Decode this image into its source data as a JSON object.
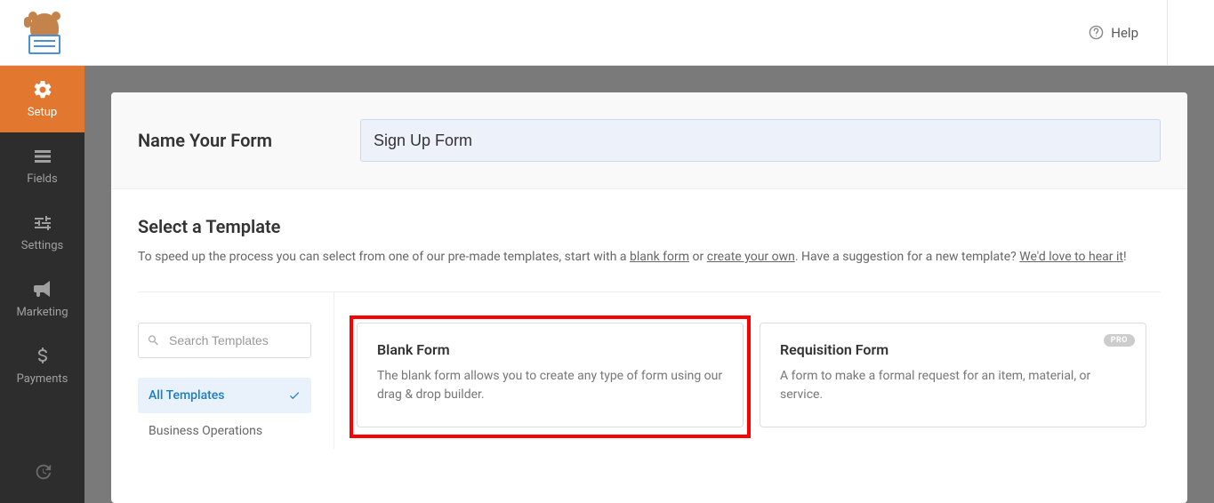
{
  "topbar": {
    "help_label": "Help"
  },
  "sidebar": {
    "items": [
      {
        "label": "Setup"
      },
      {
        "label": "Fields"
      },
      {
        "label": "Settings"
      },
      {
        "label": "Marketing"
      },
      {
        "label": "Payments"
      }
    ]
  },
  "name_section": {
    "label": "Name Your Form",
    "value": "Sign Up Form"
  },
  "template_section": {
    "title": "Select a Template",
    "desc_prefix": "To speed up the process you can select from one of our pre-made templates, start with a ",
    "blank_link": "blank form",
    "desc_mid": " or ",
    "create_link": "create your own",
    "desc_suffix": ". Have a suggestion for a new template? ",
    "hear_link": "We'd love to hear it",
    "desc_end": "!"
  },
  "search": {
    "placeholder": "Search Templates"
  },
  "categories": [
    {
      "label": "All Templates",
      "active": true
    },
    {
      "label": "Business Operations",
      "active": false
    }
  ],
  "templates": [
    {
      "title": "Blank Form",
      "desc": "The blank form allows you to create any type of form using our drag & drop builder.",
      "pro": false,
      "highlight": true
    },
    {
      "title": "Requisition Form",
      "desc": "A form to make a formal request for an item, material, or service.",
      "pro": true,
      "pro_label": "PRO",
      "highlight": false
    }
  ]
}
